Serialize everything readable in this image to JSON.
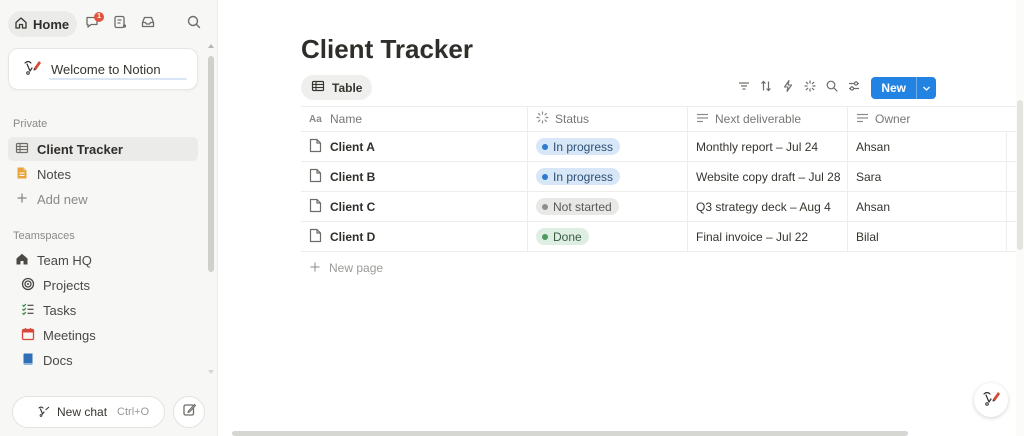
{
  "sidebar": {
    "home_label": "Home",
    "inbox_badge": "1",
    "welcome_label": "Welcome to Notion",
    "private_section": "Private",
    "private_items": [
      {
        "label": "Client Tracker",
        "icon": "table-icon"
      },
      {
        "label": "Notes",
        "icon": "page-icon"
      },
      {
        "label": "Add new",
        "icon": "plus-icon"
      }
    ],
    "teamspaces_section": "Teamspaces",
    "teamspace_name": "Team HQ",
    "teamspace_items": [
      {
        "label": "Projects",
        "icon": "target-icon"
      },
      {
        "label": "Tasks",
        "icon": "checklist-icon"
      },
      {
        "label": "Meetings",
        "icon": "calendar-icon"
      },
      {
        "label": "Docs",
        "icon": "docs-icon"
      }
    ],
    "new_chat_label": "New chat",
    "new_chat_shortcut": "Ctrl+O"
  },
  "page": {
    "title": "Client Tracker",
    "view_tab": "Table",
    "new_button": "New",
    "colors": {
      "accent": "#2383e2",
      "in_progress": "#2f7ad0",
      "not_started": "#8f8e8a",
      "done": "#4d9a61"
    }
  },
  "table": {
    "columns": [
      "Name",
      "Status",
      "Next deliverable",
      "Owner"
    ],
    "rows": [
      {
        "name": "Client A",
        "status": "In progress",
        "next": "Monthly report – Jul 24",
        "owner": "Ahsan"
      },
      {
        "name": "Client B",
        "status": "In progress",
        "next": "Website copy draft – Jul 28",
        "owner": "Sara"
      },
      {
        "name": "Client C",
        "status": "Not started",
        "next": "Q3 strategy deck – Aug 4",
        "owner": "Ahsan"
      },
      {
        "name": "Client D",
        "status": "Done",
        "next": "Final invoice – Jul 22",
        "owner": "Bilal"
      }
    ],
    "new_page_label": "New page"
  }
}
